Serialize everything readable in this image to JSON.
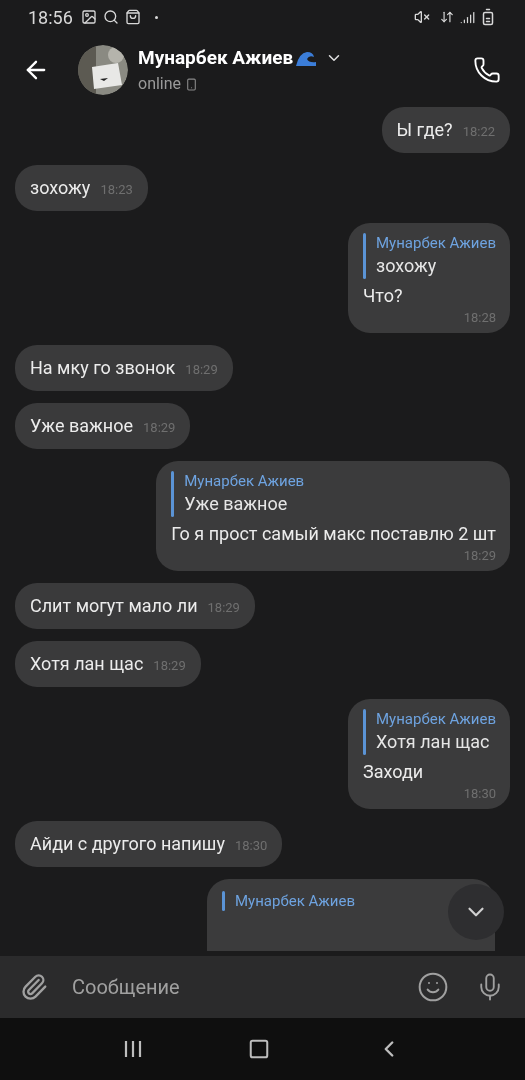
{
  "status_bar": {
    "time": "18:56"
  },
  "header": {
    "name": "Мунарбек Ажиев",
    "status": "online"
  },
  "messages": [
    {
      "kind": "text",
      "outgoing": true,
      "text": "Ы где?",
      "time": "18:22"
    },
    {
      "kind": "text",
      "outgoing": false,
      "text": "зохожу",
      "time": "18:23"
    },
    {
      "kind": "reply",
      "outgoing": true,
      "reply_name": "Мунарбек Ажиев",
      "reply_text": "зохожу",
      "text": "Что?",
      "time": "18:28"
    },
    {
      "kind": "text",
      "outgoing": false,
      "text": "На мку го звонок",
      "time": "18:29"
    },
    {
      "kind": "text",
      "outgoing": false,
      "text": "Уже важное",
      "time": "18:29"
    },
    {
      "kind": "reply",
      "outgoing": true,
      "reply_name": "Мунарбек Ажиев",
      "reply_text": "Уже важное",
      "text": "Го я прост самый макс поставлю 2 шт",
      "time": "18:29"
    },
    {
      "kind": "text",
      "outgoing": false,
      "text": "Слит могут мало ли",
      "time": "18:29"
    },
    {
      "kind": "text",
      "outgoing": false,
      "text": "Хотя лан щас",
      "time": "18:29"
    },
    {
      "kind": "reply",
      "outgoing": true,
      "reply_name": "Мунарбек Ажиев",
      "reply_text": "Хотя лан щас",
      "text": "Заходи",
      "time": "18:30"
    },
    {
      "kind": "text",
      "outgoing": false,
      "text": "Айди с другого напишу",
      "time": "18:30"
    },
    {
      "kind": "partial_reply",
      "outgoing": true,
      "reply_name": "Мунарбек Ажиев"
    }
  ],
  "composer": {
    "placeholder": "Сообщение"
  }
}
